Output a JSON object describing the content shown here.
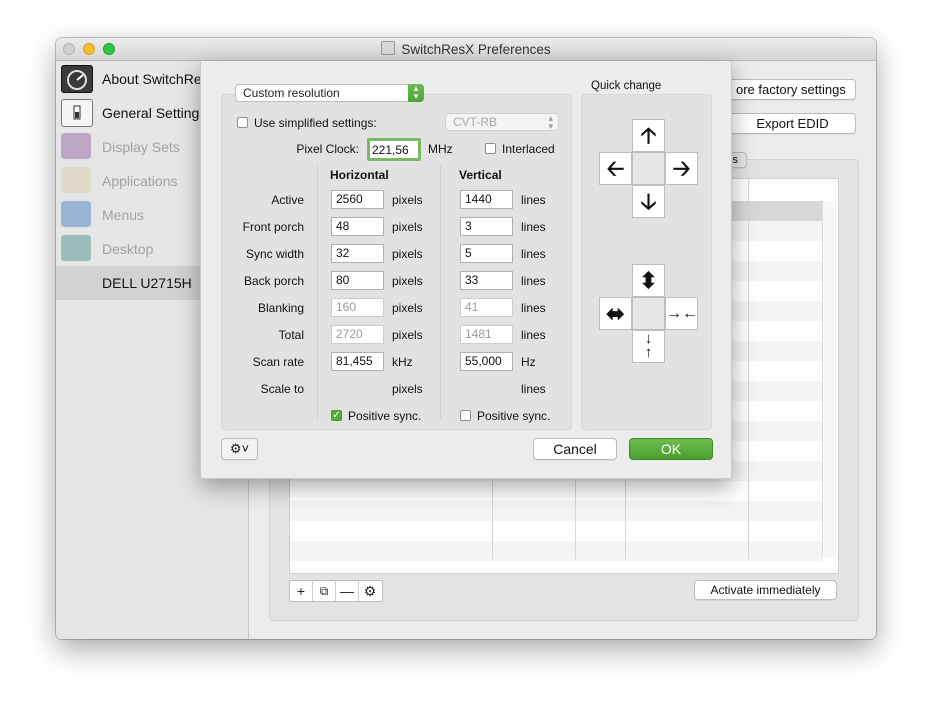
{
  "window": {
    "title": "SwitchResX Preferences"
  },
  "sidebar": {
    "items": [
      {
        "label": "About SwitchResX",
        "icon": "speedometer-icon"
      },
      {
        "label": "General Settings",
        "icon": "switch-icon"
      },
      {
        "label": "Display Sets",
        "icon": "displays-icon"
      },
      {
        "label": "Applications",
        "icon": "applications-icon"
      },
      {
        "label": "Menus",
        "icon": "menus-icon"
      },
      {
        "label": "Desktop",
        "icon": "desktop-icon"
      },
      {
        "label": "DELL U2715H",
        "icon": ""
      }
    ]
  },
  "background": {
    "factory_button": "ore factory settings",
    "export_button": "Export EDID",
    "tab_fragment": "s",
    "activate_button": "Activate immediately",
    "table_buttons": [
      "+",
      "⧉",
      "—",
      "⚙"
    ]
  },
  "sheet": {
    "mode_popup": "Custom resolution",
    "simplified_label": "Use simplified settings:",
    "simplified_checked": false,
    "cvt_popup": "CVT-RB",
    "pixel_clock_label": "Pixel Clock:",
    "pixel_clock_value": "221,56",
    "pixel_clock_unit": "MHz",
    "interlaced_label": "Interlaced",
    "interlaced_checked": false,
    "horizontal_header": "Horizontal",
    "vertical_header": "Vertical",
    "rows": [
      {
        "label": "Active",
        "h": "2560",
        "h_unit": "pixels",
        "v": "1440",
        "v_unit": "lines",
        "disabled": false
      },
      {
        "label": "Front porch",
        "h": "48",
        "h_unit": "pixels",
        "v": "3",
        "v_unit": "lines",
        "disabled": false
      },
      {
        "label": "Sync width",
        "h": "32",
        "h_unit": "pixels",
        "v": "5",
        "v_unit": "lines",
        "disabled": false
      },
      {
        "label": "Back porch",
        "h": "80",
        "h_unit": "pixels",
        "v": "33",
        "v_unit": "lines",
        "disabled": false
      },
      {
        "label": "Blanking",
        "h": "160",
        "h_unit": "pixels",
        "v": "41",
        "v_unit": "lines",
        "disabled": true
      },
      {
        "label": "Total",
        "h": "2720",
        "h_unit": "pixels",
        "v": "1481",
        "v_unit": "lines",
        "disabled": true
      },
      {
        "label": "Scan rate",
        "h": "81,455",
        "h_unit": "kHz",
        "v": "55,000",
        "v_unit": "Hz",
        "disabled": false
      },
      {
        "label": "Scale to",
        "h": "",
        "h_unit": "pixels",
        "v": "",
        "v_unit": "lines",
        "disabled": false
      }
    ],
    "h_positive_sync": "Positive sync.",
    "h_positive_checked": true,
    "v_positive_sync": "Positive sync.",
    "v_positive_checked": false,
    "quick_change_label": "Quick change",
    "cancel_label": "Cancel",
    "ok_label": "OK",
    "accent_color": "#58a93e"
  }
}
